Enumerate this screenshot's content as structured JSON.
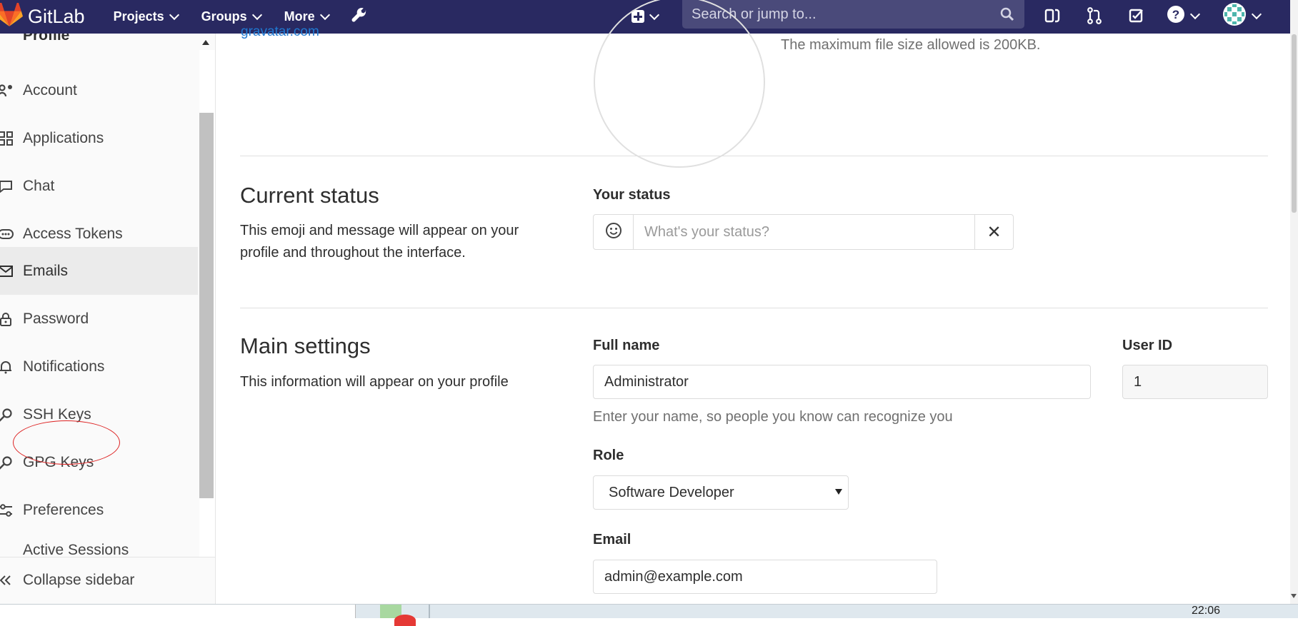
{
  "navbar": {
    "brand": "GitLab",
    "menus": [
      "Projects",
      "Groups",
      "More"
    ],
    "search_placeholder": "Search or jump to...",
    "icons": [
      "gitlab-logo-icon",
      "wrench-icon",
      "plus-icon",
      "search-icon",
      "sidebar-panel-icon",
      "merge-request-icon",
      "todo-check-icon",
      "help-icon",
      "user-avatar-icon"
    ]
  },
  "sidebar": {
    "top_partial_label": "Profile",
    "items": [
      {
        "label": "Account",
        "icon": "account-gear-icon"
      },
      {
        "label": "Applications",
        "icon": "applications-grid-icon"
      },
      {
        "label": "Chat",
        "icon": "chat-icon"
      },
      {
        "label": "Access Tokens",
        "icon": "token-icon"
      },
      {
        "label": "Emails",
        "icon": "envelope-icon",
        "active": true
      },
      {
        "label": "Password",
        "icon": "lock-icon"
      },
      {
        "label": "Notifications",
        "icon": "bell-icon"
      },
      {
        "label": "SSH Keys",
        "icon": "key-icon"
      },
      {
        "label": "GPG Keys",
        "icon": "key-icon"
      },
      {
        "label": "Preferences",
        "icon": "sliders-icon"
      }
    ],
    "partial_item": "Active Sessions",
    "collapse_label": "Collapse sidebar"
  },
  "avatar_section": {
    "email_fragment": "gravatar.com",
    "file_size_hint": "The maximum file size allowed is 200KB."
  },
  "current_status": {
    "title": "Current status",
    "description": "This emoji and message will appear on your profile and throughout the interface.",
    "your_status_label": "Your status",
    "status_placeholder": "What's your status?",
    "clear_glyph": "✕"
  },
  "main_settings": {
    "title": "Main settings",
    "description": "This information will appear on your profile",
    "full_name_label": "Full name",
    "full_name_value": "Administrator",
    "full_name_help": "Enter your name, so people you know can recognize you",
    "user_id_label": "User ID",
    "user_id_value": "1",
    "role_label": "Role",
    "role_value": "Software Developer",
    "email_label": "Email",
    "email_value": "admin@example.com"
  },
  "taskbar": {
    "time_fragment": "22:06"
  },
  "colors": {
    "navbar": "#292961",
    "link": "#1f78d1",
    "annotation": "#dd2222"
  }
}
